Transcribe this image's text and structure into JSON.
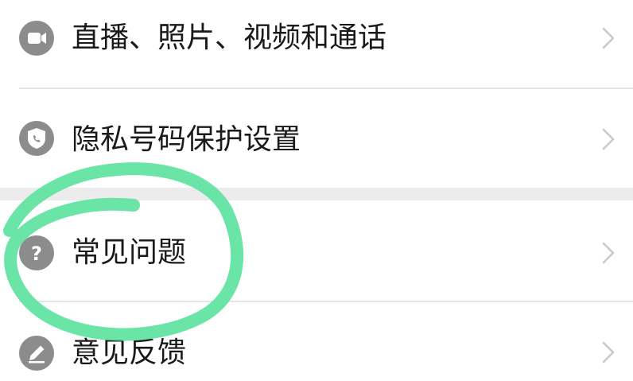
{
  "settings_list": {
    "items": [
      {
        "label": "直播、照片、视频和通话",
        "icon": "video-camera-icon"
      },
      {
        "label": "隐私号码保护设置",
        "icon": "shield-phone-icon"
      },
      {
        "label": "常见问题",
        "icon": "question-mark-icon"
      },
      {
        "label": "意见反馈",
        "icon": "pencil-icon"
      }
    ],
    "chevron_icon": "chevron-right-icon"
  },
  "colors": {
    "icon_background": "#8c8c8c",
    "section_gap": "#ececec",
    "highlight_stroke": "#5ee3a0",
    "text": "#1a1a1a",
    "chevron": "#c8c8c8"
  }
}
